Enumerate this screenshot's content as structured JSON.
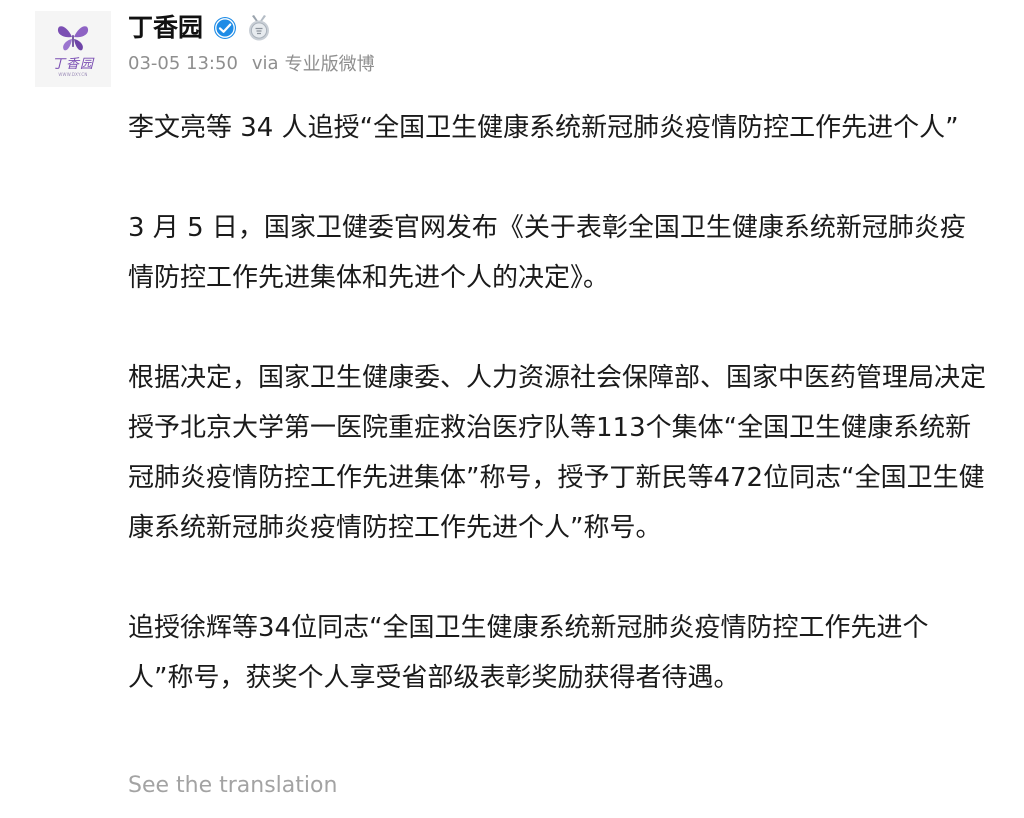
{
  "post": {
    "author": {
      "name": "丁香园",
      "avatar_wordmark": "丁香园",
      "avatar_url_text": "WWW.DXY.CN",
      "verified_icon": "verified-badge-icon",
      "medal_icon": "medal-icon",
      "brand_color": "#7b4fb3"
    },
    "meta": {
      "time": "03-05 13:50",
      "via": "via",
      "source": "专业版微博"
    },
    "paragraphs": [
      "李文亮等 34 人追授“全国卫生健康系统新冠肺炎疫情防控工作先进个人”",
      "3 月 5 日，国家卫健委官网发布《关于表彰全国卫生健康系统新冠肺炎疫情防控工作先进集体和先进个人的决定》。",
      "根据决定，国家卫生健康委、人力资源社会保障部、国家中医药管理局决定授予北京大学第一医院重症救治医疗队等113个集体“全国卫生健康系统新冠肺炎疫情防控工作先进集体”称号，授予丁新民等472位同志“全国卫生健康系统新冠肺炎疫情防控工作先进个人”称号。",
      "追授徐辉等34位同志“全国卫生健康系统新冠肺炎疫情防控工作先进个人”称号，获奖个人享受省部级表彰奖励获得者待遇。"
    ],
    "translate_label": "See the translation"
  }
}
